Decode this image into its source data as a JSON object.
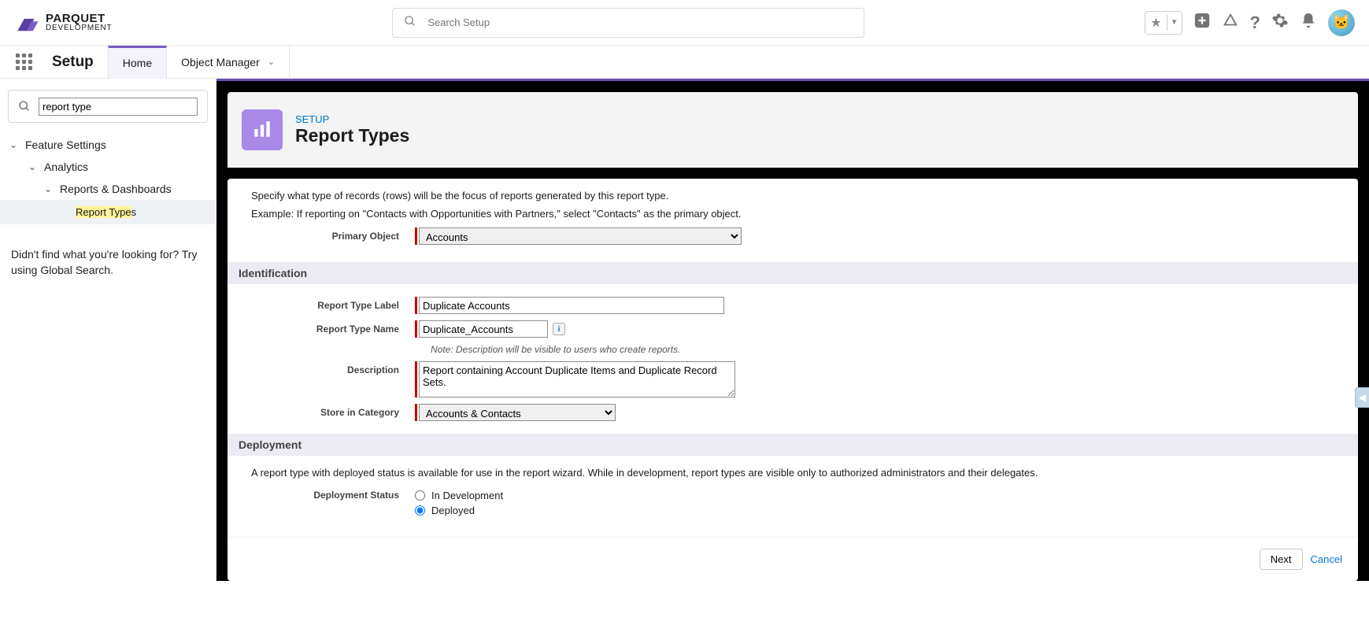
{
  "logo": {
    "line1": "PARQUET",
    "line2": "DEVELOPMENT"
  },
  "search": {
    "placeholder": "Search Setup"
  },
  "nav": {
    "setup": "Setup",
    "home": "Home",
    "object_manager": "Object Manager"
  },
  "sidebar": {
    "search_value": "report type",
    "tree": {
      "feature_settings": "Feature Settings",
      "analytics": "Analytics",
      "reports_dashboards": "Reports & Dashboards",
      "report_types_hl": "Report Type",
      "report_types_suffix": "s"
    },
    "note": "Didn't find what you're looking for? Try using Global Search."
  },
  "page": {
    "breadcrumb": "SETUP",
    "title": "Report Types",
    "intro1": "Specify what type of records (rows) will be the focus of reports generated by this report type.",
    "intro2": "Example: If reporting on \"Contacts with Opportunities with Partners,\" select \"Contacts\" as the primary object."
  },
  "form": {
    "primary_object_label": "Primary Object",
    "primary_object_value": "Accounts",
    "sec_identification": "Identification",
    "label_label": "Report Type Label",
    "label_value": "Duplicate Accounts",
    "name_label": "Report Type Name",
    "name_value": "Duplicate_Accounts",
    "note": "Note: Description will be visible to users who create reports.",
    "desc_label": "Description",
    "desc_value": "Report containing Account Duplicate Items and Duplicate Record Sets.",
    "category_label": "Store in Category",
    "category_value": "Accounts & Contacts",
    "sec_deployment": "Deployment",
    "deploy_intro": "A report type with deployed status is available for use in the report wizard. While in development, report types are visible only to authorized administrators and their delegates.",
    "status_label": "Deployment Status",
    "status_in_dev": "In Development",
    "status_deployed": "Deployed"
  },
  "footer": {
    "next": "Next",
    "cancel": "Cancel"
  }
}
